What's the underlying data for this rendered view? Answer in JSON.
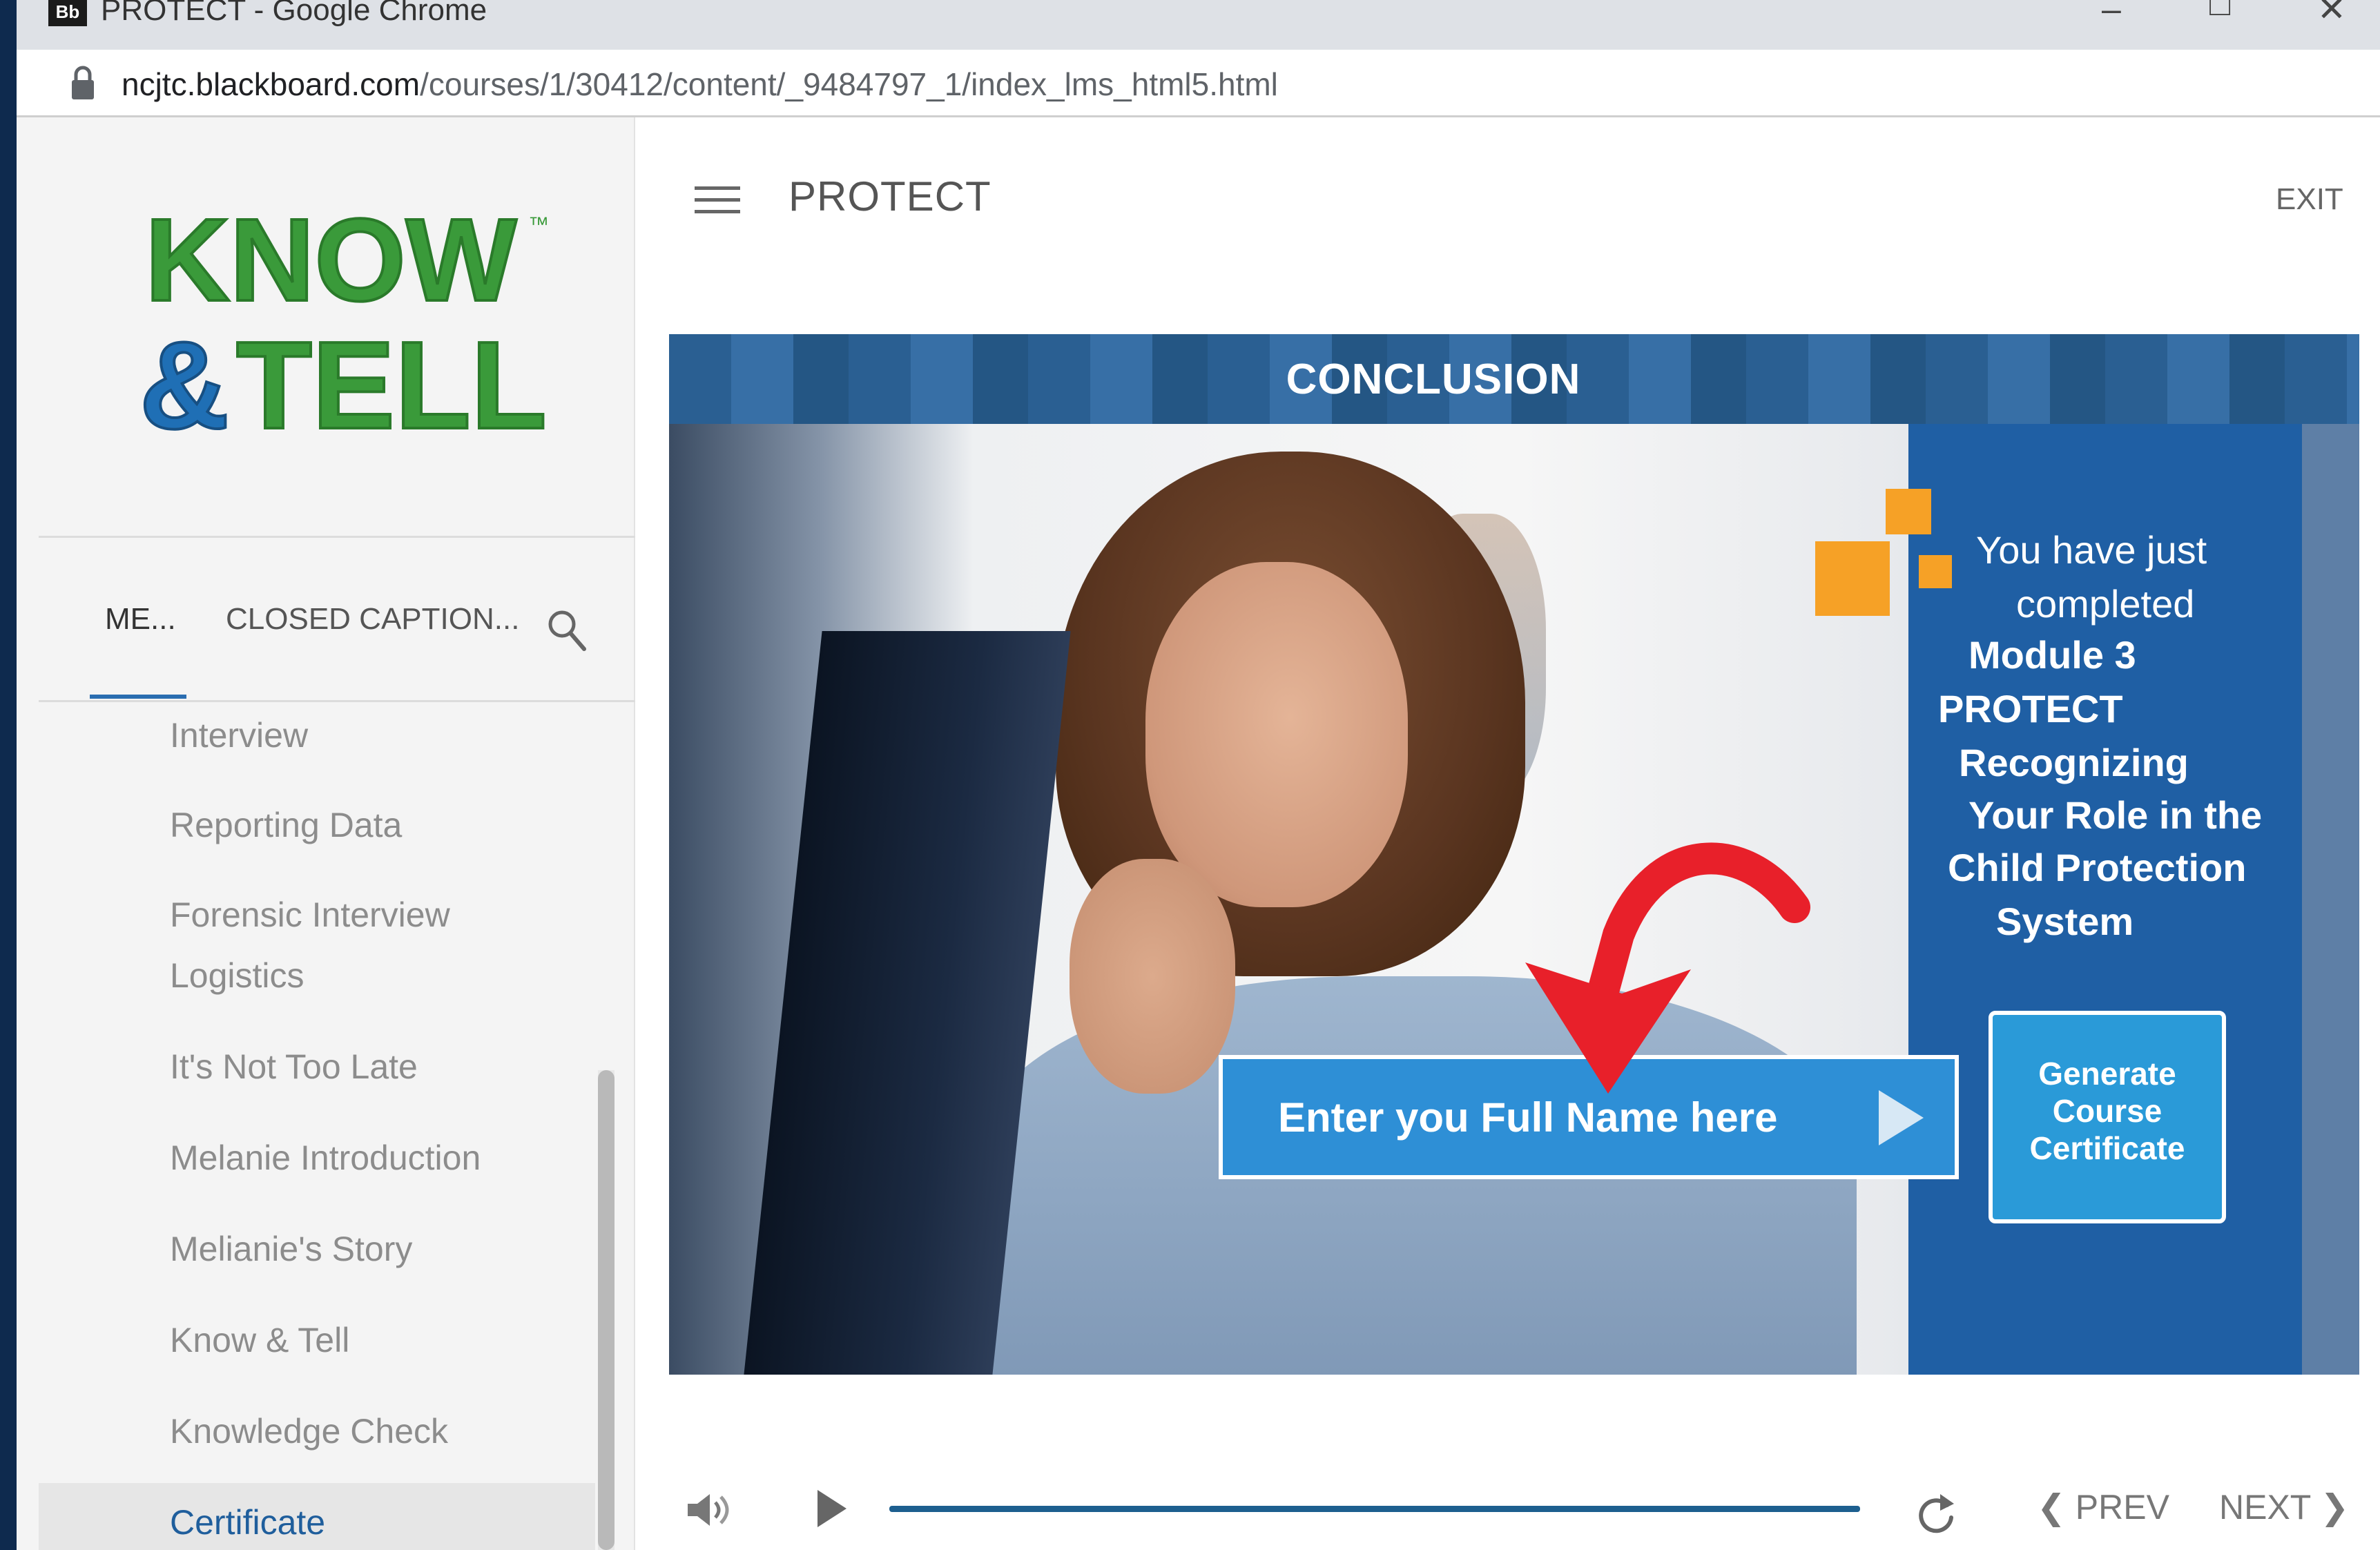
{
  "browser": {
    "app_icon_text": "Bb",
    "window_title": "PROTECT - Google Chrome",
    "url_host": "ncjtc.blackboard.com",
    "url_path": "/courses/1/30412/content/_9484797_1/index_lms_html5.html",
    "window_controls": [
      "minimize-icon",
      "maximize-icon",
      "close-icon"
    ]
  },
  "sidebar": {
    "logo": {
      "line1": "KNOW",
      "line2": "&TELL",
      "trademark": "™",
      "colors": {
        "know": "#3a9a3a",
        "tell_amp": "#1f6fb5",
        "tell": "#3a9a3a"
      }
    },
    "tabs": [
      {
        "label": "ME...",
        "active": true
      },
      {
        "label": "CLOSED CAPTION...",
        "active": false
      }
    ],
    "nav_items": [
      "Interview",
      "Reporting Data",
      "Forensic Interview",
      "Logistics",
      "It's Not Too Late",
      "Melanie Introduction",
      "Melianie's Story",
      "Know & Tell",
      "Knowledge Check",
      "Certificate"
    ],
    "active_item": "Certificate"
  },
  "header": {
    "menu_icon": "hamburger-icon",
    "course_title": "PROTECT",
    "exit_label": "EXIT"
  },
  "slide": {
    "heading": "CONCLUSION",
    "panel_lines": [
      "You have just",
      "completed",
      "Module 3",
      "PROTECT",
      "Recognizing",
      "Your Role in the",
      "Child Protection",
      "System"
    ],
    "name_input_placeholder": "Enter you Full Name here",
    "certificate_button": [
      "Generate",
      "Course",
      "Certificate"
    ],
    "colors": {
      "panel": "#1f5fa4",
      "accent_orange": "#f6a126",
      "input": "#2e8fd6",
      "arrow": "#e8202a"
    }
  },
  "player": {
    "volume_icon": "volume-icon",
    "play_icon": "play-icon",
    "progress": 1.0,
    "replay_icon": "replay-icon",
    "prev_label": "PREV",
    "next_label": "NEXT"
  }
}
